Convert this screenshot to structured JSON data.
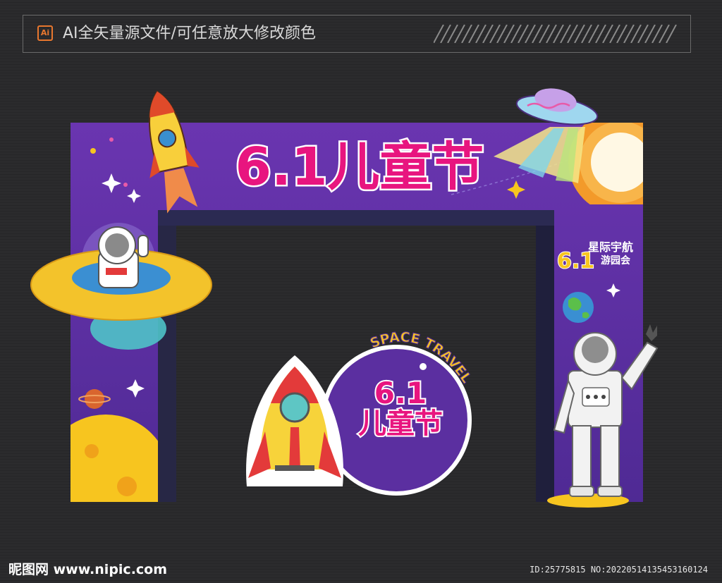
{
  "header": {
    "ai_badge": "Ai",
    "description": "AI全矢量源文件/可任意放大修改颜色"
  },
  "arch": {
    "main_title": "6.1儿童节",
    "side_badge_number": "6.1",
    "side_badge_line1": "星际宇航",
    "side_badge_line2": "游园会"
  },
  "sign": {
    "arc_text": "SPACE TRAVEL",
    "number": "6.1",
    "title": "儿童节"
  },
  "footer": {
    "site": "昵图网 www.nipic.com",
    "id_text": "ID:25775815 NO:20220514135453160124"
  },
  "colors": {
    "background": "#2a2a2c",
    "arch_purple": "#5b2fa0",
    "arch_dark": "#2b2a52",
    "title_pink": "#e8157f",
    "accent_yellow": "#f7c51f"
  }
}
